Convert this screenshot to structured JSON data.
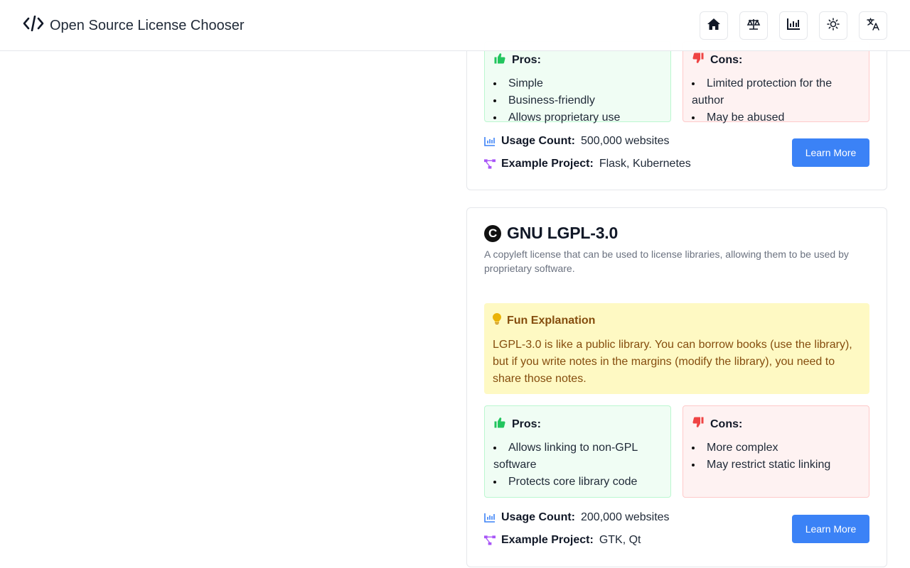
{
  "app": {
    "title": "Open Source License Chooser"
  },
  "header": {
    "buttons": [
      {
        "icon": "home-icon"
      },
      {
        "icon": "scale-icon"
      },
      {
        "icon": "chart-icon"
      },
      {
        "icon": "sun-icon"
      },
      {
        "icon": "translate-icon"
      }
    ]
  },
  "cards": [
    {
      "pros_title": "Pros:",
      "cons_title": "Cons:",
      "pros": [
        "Simple",
        "Business-friendly",
        "Allows proprietary use"
      ],
      "cons": [
        "Limited protection for the author",
        "May be abused"
      ],
      "usage_label": "Usage Count:",
      "usage_value": "500,000 websites",
      "example_label": "Example Project:",
      "example_value": "Flask, Kubernetes",
      "learn_more": "Learn More"
    },
    {
      "icon_glyph": "C",
      "title": "GNU LGPL-3.0",
      "description": "A copyleft license that can be used to license libraries, allowing them to be used by proprietary software.",
      "fun_title": "Fun Explanation",
      "fun_text": "LGPL-3.0 is like a public library. You can borrow books (use the library), but if you write notes in the margins (modify the library), you need to share those notes.",
      "pros_title": "Pros:",
      "cons_title": "Cons:",
      "pros": [
        "Allows linking to non-GPL software",
        "Protects core library code"
      ],
      "cons": [
        "More complex",
        "May restrict static linking"
      ],
      "usage_label": "Usage Count:",
      "usage_value": "200,000 websites",
      "example_label": "Example Project:",
      "example_value": "GTK, Qt",
      "learn_more": "Learn More"
    }
  ],
  "colors": {
    "accent": "#3b82f6",
    "fun_bg": "#fef9c3",
    "fun_text": "#854d0e",
    "pros_bg": "#f0fdf4",
    "cons_bg": "#fef2f2",
    "thumb_up": "#22c55e",
    "thumb_down": "#ef4444",
    "usage_icon": "#3b82f6",
    "example_icon": "#a855f7"
  }
}
